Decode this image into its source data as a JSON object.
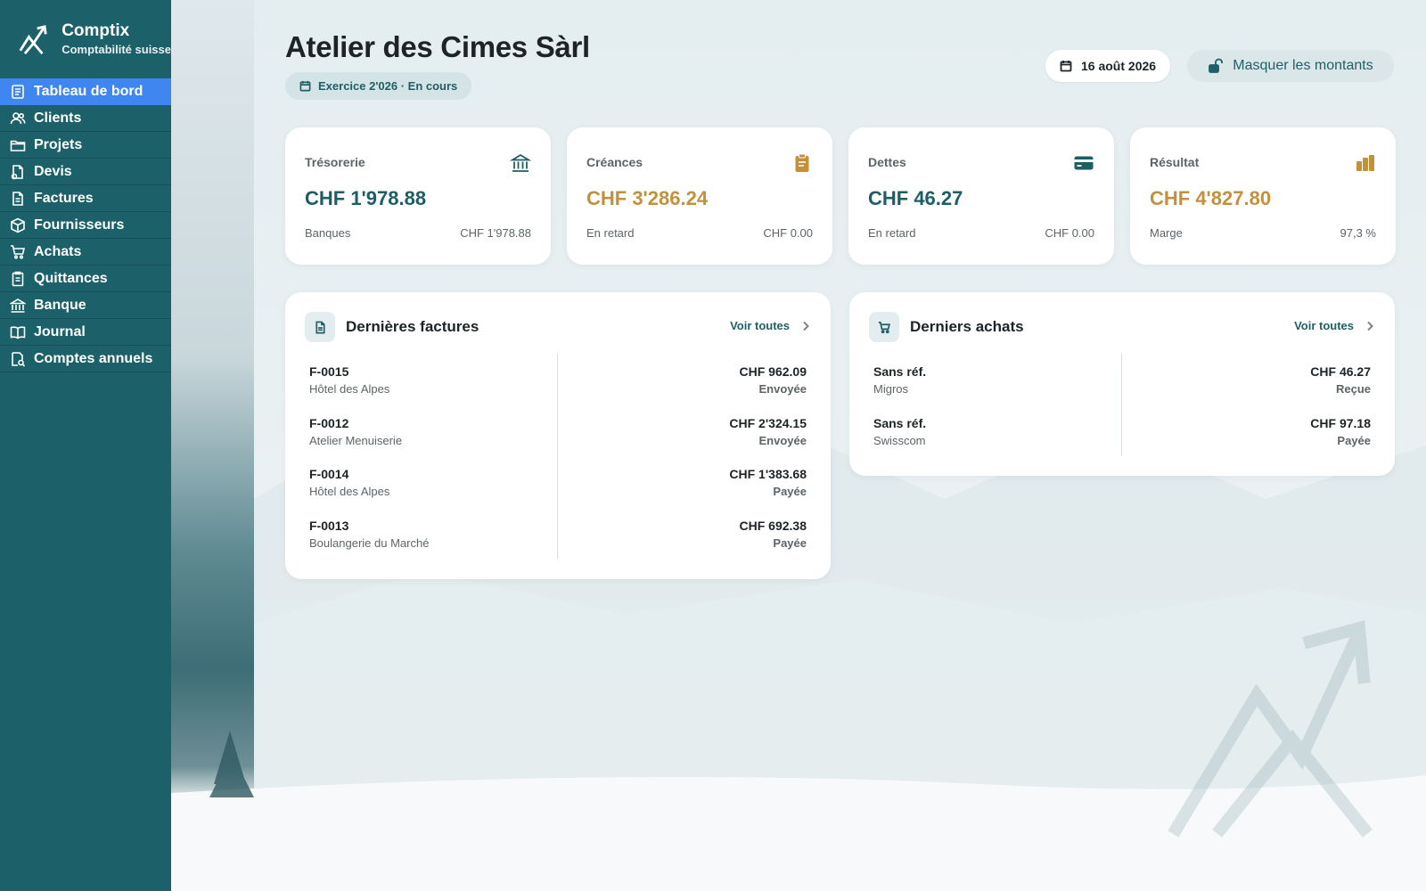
{
  "sidebar": {
    "brand_name": "Comptix",
    "brand_sub": "Comptabilité suisse",
    "items": [
      {
        "label": "Tableau de bord",
        "icon": "dashboard-icon"
      },
      {
        "label": "Clients",
        "icon": "users-icon"
      },
      {
        "label": "Projets",
        "icon": "folder-icon"
      },
      {
        "label": "Devis",
        "icon": "quote-icon"
      },
      {
        "label": "Factures",
        "icon": "document-icon"
      },
      {
        "label": "Fournisseurs",
        "icon": "box-icon"
      },
      {
        "label": "Achats",
        "icon": "cart-icon"
      },
      {
        "label": "Quittances",
        "icon": "receipt-icon"
      },
      {
        "label": "Banque",
        "icon": "bank-icon"
      },
      {
        "label": "Journal",
        "icon": "book-icon"
      },
      {
        "label": "Comptes annuels",
        "icon": "report-icon"
      }
    ],
    "active_index": 0
  },
  "header": {
    "title": "Atelier des Cimes Sàrl",
    "exercice": "Exercice 2'026 · En cours",
    "date": "16 août 2026",
    "mask_label": "Masquer les montants"
  },
  "kpis": [
    {
      "label": "Trésorerie",
      "value": "CHF 1'978.88",
      "foot_label": "Banques",
      "foot_value": "CHF 1'978.88",
      "color": "#1b5e66",
      "icon": "bank-icon"
    },
    {
      "label": "Créances",
      "value": "CHF 3'286.24",
      "foot_label": "En retard",
      "foot_value": "CHF 0.00",
      "color": "#c4913a",
      "icon": "clipboard-icon"
    },
    {
      "label": "Dettes",
      "value": "CHF 46.27",
      "foot_label": "En retard",
      "foot_value": "CHF 0.00",
      "color": "#1b5e66",
      "icon": "credit-card-icon"
    },
    {
      "label": "Résultat",
      "value": "CHF 4'827.80",
      "foot_label": "Marge",
      "foot_value": "97,3 %",
      "color": "#c4913a",
      "icon": "bar-chart-icon"
    }
  ],
  "invoices": {
    "title": "Dernières factures",
    "link": "Voir toutes",
    "rows": [
      {
        "ref": "F-0015",
        "client": "Hôtel des Alpes",
        "amount": "CHF 962.09",
        "status": "Envoyée"
      },
      {
        "ref": "F-0012",
        "client": "Atelier Menuiserie",
        "amount": "CHF 2'324.15",
        "status": "Envoyée"
      },
      {
        "ref": "F-0014",
        "client": "Hôtel des Alpes",
        "amount": "CHF 1'383.68",
        "status": "Payée"
      },
      {
        "ref": "F-0013",
        "client": "Boulangerie du Marché",
        "amount": "CHF 692.38",
        "status": "Payée"
      }
    ]
  },
  "purchases": {
    "title": "Derniers achats",
    "link": "Voir toutes",
    "rows": [
      {
        "ref": "Sans réf.",
        "supplier": "Migros",
        "amount": "CHF 46.27",
        "status": "Reçue"
      },
      {
        "ref": "Sans réf.",
        "supplier": "Swisscom",
        "amount": "CHF 97.18",
        "status": "Payée"
      }
    ]
  }
}
